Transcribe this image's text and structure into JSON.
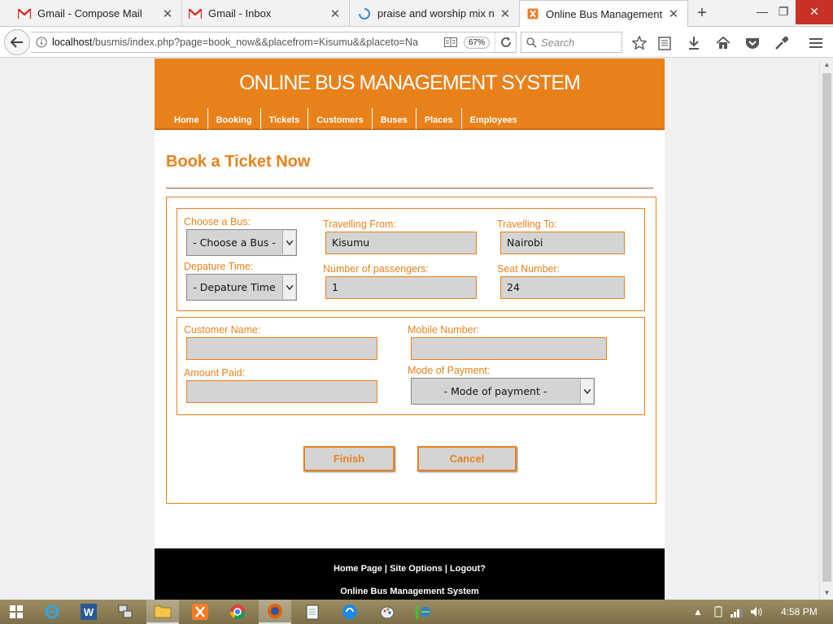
{
  "browser": {
    "tabs": [
      {
        "title": "Gmail - Compose Mail",
        "icon": "gmail-icon"
      },
      {
        "title": "Gmail - Inbox",
        "icon": "gmail-icon"
      },
      {
        "title": "praise and worship mix n...",
        "icon": "loading-icon"
      },
      {
        "title": "Online Bus Management ...",
        "icon": "xampp-icon"
      }
    ],
    "url_host": "localhost",
    "url_path": "/busmis/index.php?page=book_now&&placefrom=Kisumu&&placeto=Na",
    "zoom": "67%",
    "search_placeholder": "Search"
  },
  "site": {
    "title": "ONLINE BUS MANAGEMENT SYSTEM",
    "menu": [
      "Home",
      "Booking",
      "Tickets",
      "Customers",
      "Buses",
      "Places",
      "Employees"
    ]
  },
  "form": {
    "heading": "Book a Ticket Now",
    "choose_bus_label": "Choose a Bus:",
    "choose_bus_value": "- Choose a Bus -",
    "travelling_from_label": "Travelling From:",
    "travelling_from_value": "Kisumu",
    "travelling_to_label": "Travelling To:",
    "travelling_to_value": "Nairobi",
    "departure_label": "Depature Time:",
    "departure_value": "- Depature Time",
    "passengers_label": "Number of passengers:",
    "passengers_value": "1",
    "seat_label": "Seat Number:",
    "seat_value": "24",
    "customer_name_label": "Customer Name:",
    "customer_name_value": "",
    "mobile_label": "Mobile Number:",
    "mobile_value": "",
    "amount_label": "Amount Paid:",
    "amount_value": "",
    "payment_label": "Mode of Payment:",
    "payment_value": "- Mode of payment -",
    "finish_label": "Finish",
    "cancel_label": "Cancel"
  },
  "footer": {
    "links": "Home Page | Site Options | Logout?",
    "system_name": "Online Bus Management System"
  },
  "taskbar": {
    "time": "4:58 PM"
  },
  "colors": {
    "accent": "#e9811b",
    "input_bg": "#d4d4d4",
    "footer_bg": "#000000"
  }
}
